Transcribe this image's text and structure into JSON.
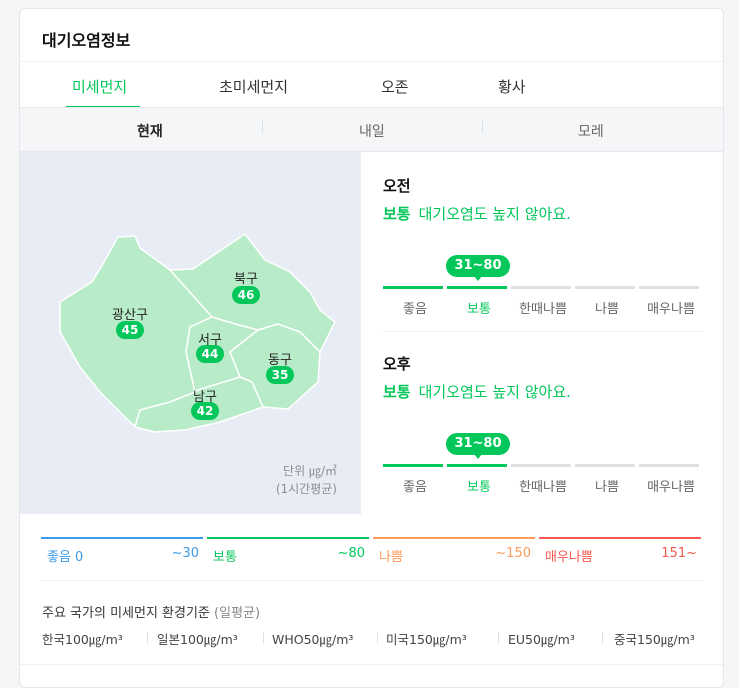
{
  "title": "대기오염정보",
  "tabs": [
    {
      "label": "미세먼지",
      "active": true
    },
    {
      "label": "초미세먼지",
      "active": false
    },
    {
      "label": "오존",
      "active": false
    },
    {
      "label": "황사",
      "active": false
    }
  ],
  "subtabs": [
    {
      "label": "현재",
      "active": true
    },
    {
      "label": "내일",
      "active": false
    },
    {
      "label": "모레",
      "active": false
    }
  ],
  "map": {
    "districts": [
      {
        "name": "광산구",
        "value": "45"
      },
      {
        "name": "북구",
        "value": "46"
      },
      {
        "name": "서구",
        "value": "44"
      },
      {
        "name": "동구",
        "value": "35"
      },
      {
        "name": "남구",
        "value": "42"
      }
    ],
    "unit_line1": "단위 ㎍/㎥",
    "unit_line2": "(1시간평균)",
    "fill_color": "#b8ecc8",
    "badge_color": "#03c75a"
  },
  "forecast": [
    {
      "label": "오전",
      "grade": "보통",
      "message": "대기오염도 높지 않아요.",
      "range": "31~80",
      "active_index": 1
    },
    {
      "label": "오후",
      "grade": "보통",
      "message": "대기오염도 높지 않아요.",
      "range": "31~80",
      "active_index": 1
    }
  ],
  "levels": [
    "좋음",
    "보통",
    "한때나쁨",
    "나쁨",
    "매우나쁨"
  ],
  "legend": [
    {
      "label": "좋음 0",
      "max": "~30",
      "color": "#3d9be9"
    },
    {
      "label": "보통",
      "max": "~80",
      "color": "#03c75a"
    },
    {
      "label": "나쁨",
      "max": "~150",
      "color": "#fd9b5a"
    },
    {
      "label": "매우나쁨",
      "max": "151~",
      "color": "#f55a4e"
    }
  ],
  "standards": {
    "title": "주요 국가의 미세먼지 환경기준",
    "note": "(일평균)",
    "items": [
      "한국100㎍/m³",
      "일본100㎍/m³",
      "WHO50㎍/m³",
      "미국150㎍/m³",
      "EU50㎍/m³",
      "중국150㎍/m³"
    ]
  }
}
